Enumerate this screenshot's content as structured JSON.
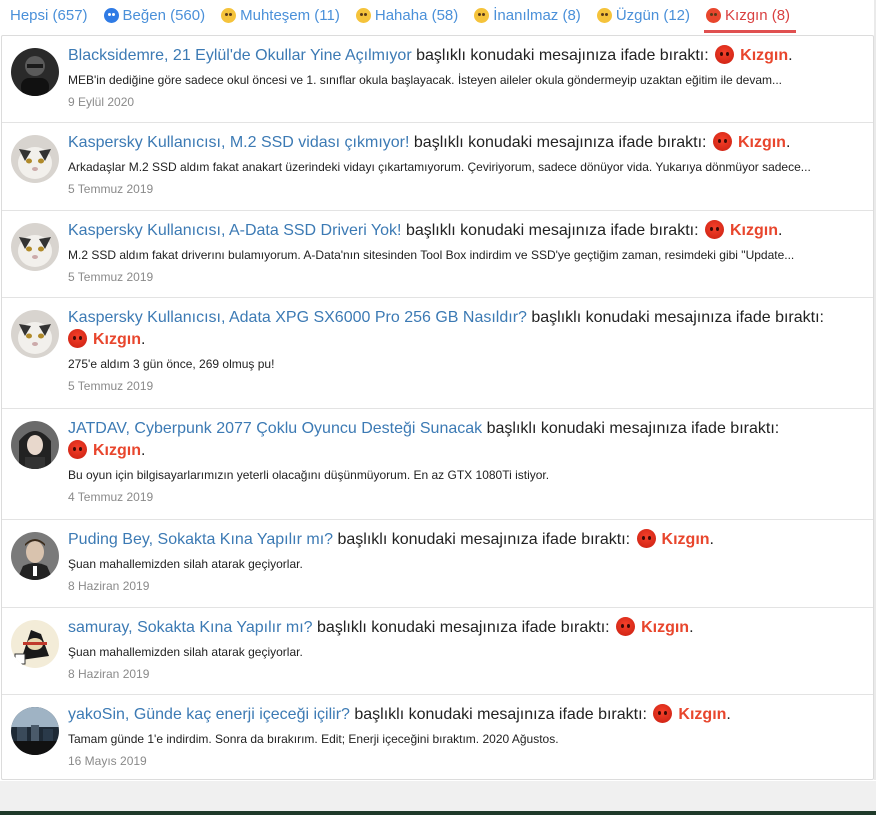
{
  "tabs": [
    {
      "label": "Hepsi (657)",
      "icon": null
    },
    {
      "label": "Beğen (560)",
      "icon": "thumbs-up-icon"
    },
    {
      "label": "Muhteşem (11)",
      "icon": "heart-eyes-icon"
    },
    {
      "label": "Hahaha (58)",
      "icon": "laughing-icon"
    },
    {
      "label": "İnanılmaz (8)",
      "icon": "surprised-icon"
    },
    {
      "label": "Üzgün (12)",
      "icon": "sad-icon"
    },
    {
      "label": "Kızgın (8)",
      "icon": "angry-icon"
    }
  ],
  "reaction_word": "Kızgın",
  "middle_text": "başlıklı konudaki mesajınıza ifade bıraktı:",
  "items": [
    {
      "user": "Blacksidemre",
      "thread": "21 Eylül'de Okullar Yine Açılmıyor",
      "snippet": "MEB'in dediğine göre sadece okul öncesi ve 1. sınıflar okula başlayacak. İsteyen aileler okula göndermeyip uzaktan eğitim ile devam...",
      "date": "9 Eylül 2020"
    },
    {
      "user": "Kaspersky Kullanıcısı",
      "thread": "M.2 SSD vidası çıkmıyor!",
      "snippet": "Arkadaşlar M.2 SSD aldım fakat anakart üzerindeki vidayı çıkartamıyorum. Çeviriyorum, sadece dönüyor vida. Yukarıya dönmüyor sadece...",
      "date": "5 Temmuz 2019"
    },
    {
      "user": "Kaspersky Kullanıcısı",
      "thread": "A-Data SSD Driveri Yok!",
      "snippet": "M.2 SSD aldım fakat driverını bulamıyorum. A-Data'nın sitesinden Tool Box indirdim ve SSD'ye geçtiğim zaman, resimdeki gibi \"Update...",
      "date": "5 Temmuz 2019"
    },
    {
      "user": "Kaspersky Kullanıcısı",
      "thread": "Adata XPG SX6000 Pro 256 GB Nasıldır?",
      "snippet": "275'e aldım 3 gün önce, 269 olmuş pu!",
      "date": "5 Temmuz 2019"
    },
    {
      "user": "JATDAV",
      "thread": "Cyberpunk 2077 Çoklu Oyuncu Desteği Sunacak",
      "snippet": "Bu oyun için bilgisayarlarımızın yeterli olacağını düşünmüyorum. En az GTX 1080Ti istiyor.",
      "date": "4 Temmuz 2019"
    },
    {
      "user": "Puding Bey",
      "thread": "Sokakta Kına Yapılır mı?",
      "snippet": "Şuan mahallemizden silah atarak geçiyorlar.",
      "date": "8 Haziran 2019"
    },
    {
      "user": "samuray",
      "thread": "Sokakta Kına Yapılır mı?",
      "snippet": "Şuan mahallemizden silah atarak geçiyorlar.",
      "date": "8 Haziran 2019"
    },
    {
      "user": "yakoSin",
      "thread": "Günde kaç enerji içeceği içilir?",
      "snippet": "Tamam günde 1'e indirdim. Sonra da bırakırım. Edit; Enerji içeceğini bıraktım. 2020 Ağustos.",
      "date": "16 Mayıs 2019"
    }
  ]
}
